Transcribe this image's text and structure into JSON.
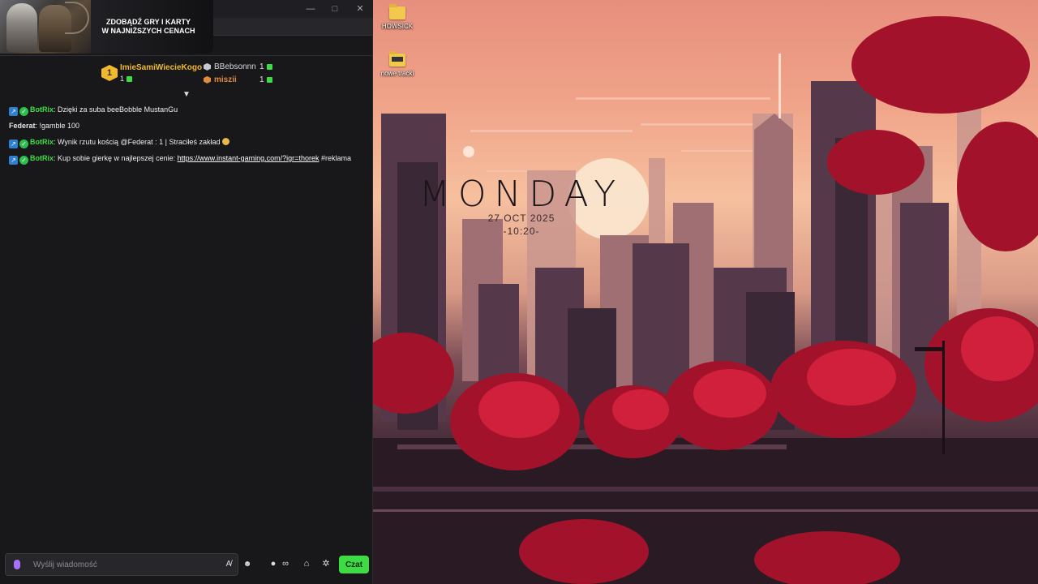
{
  "window": {
    "minimize_label": "—",
    "maximize_label": "□",
    "close_label": "✕"
  },
  "ad": {
    "line1": "ZDOBĄDŹ GRY I KARTY",
    "line2": "W NAJNIŻSZYCH CENACH"
  },
  "leaderboard": {
    "first": {
      "rank": "1",
      "name": "ImieSamiWiecieKogo",
      "score": "1"
    },
    "second": {
      "name": "BBebsonnn",
      "score": "1"
    },
    "third": {
      "name": "miszii",
      "score": "1"
    },
    "colors": {
      "first": "#f0b92e",
      "second": "#c8c8d0",
      "third": "#e08a3c"
    }
  },
  "messages": [
    {
      "user": "BotRix",
      "user_color": "#3ddc45",
      "badges": true,
      "text": "Dzięki za suba beeBobble MustanGu",
      "link": "",
      "after": "",
      "emote": false
    },
    {
      "user": "Federat",
      "user_color": "#e6e6ea",
      "badges": false,
      "text": "!gamble 100",
      "link": "",
      "after": "",
      "emote": false
    },
    {
      "user": "BotRix",
      "user_color": "#3ddc45",
      "badges": true,
      "text": "Wynik rzutu kością @Federat : 1 | Straciłeś zakład",
      "link": "",
      "after": "",
      "emote": true
    },
    {
      "user": "BotRix",
      "user_color": "#3ddc45",
      "badges": true,
      "text": "Kup sobie gierkę w najlepszej cenie:",
      "link": "https://www.instant-gaming.com/?igr=thorek",
      "after": "#reklama",
      "emote": false
    }
  ],
  "chat_input": {
    "placeholder": "Wyślij wiadomość"
  },
  "send_button": {
    "label": "Czat"
  },
  "infinity_label": "∞",
  "desktop": {
    "icons": [
      {
        "label": "HOWSICK"
      },
      {
        "label": "nowe tracki"
      }
    ],
    "clock": {
      "day": "MONDAY",
      "date": "27 OCT 2025",
      "time": "-10:20-"
    }
  }
}
